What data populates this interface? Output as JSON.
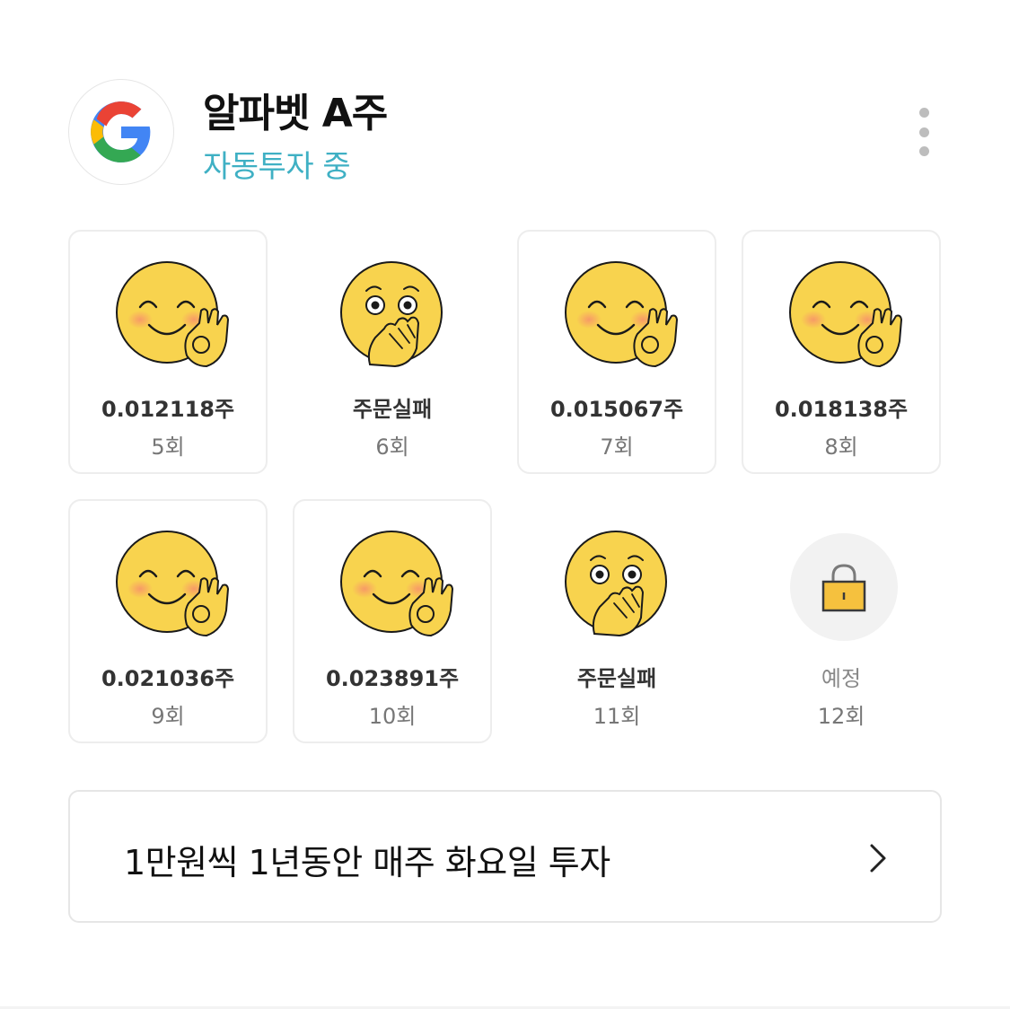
{
  "header": {
    "logo_icon": "google-g-icon",
    "title": "알파벳 A주",
    "status": "자동투자 중",
    "status_color": "#3fb0c4",
    "more_icon": "more-vertical-icon"
  },
  "rounds": [
    {
      "value": "0.012118주",
      "count": "5회",
      "state": "success",
      "emoji": "ok-hand-emoji-icon"
    },
    {
      "value": "주문실패",
      "count": "6회",
      "state": "failed",
      "emoji": "surprised-emoji-icon"
    },
    {
      "value": "0.015067주",
      "count": "7회",
      "state": "success",
      "emoji": "ok-hand-emoji-icon"
    },
    {
      "value": "0.018138주",
      "count": "8회",
      "state": "success",
      "emoji": "ok-hand-emoji-icon"
    },
    {
      "value": "0.021036주",
      "count": "9회",
      "state": "success",
      "emoji": "ok-hand-emoji-icon"
    },
    {
      "value": "0.023891주",
      "count": "10회",
      "state": "success",
      "emoji": "ok-hand-emoji-icon"
    },
    {
      "value": "주문실패",
      "count": "11회",
      "state": "failed",
      "emoji": "surprised-emoji-icon"
    },
    {
      "value": "예정",
      "count": "12회",
      "state": "scheduled",
      "emoji": "lock-icon"
    }
  ],
  "plan": {
    "text": "1만원씩 1년동안 매주 화요일 투자",
    "chevron_icon": "chevron-right-icon"
  }
}
